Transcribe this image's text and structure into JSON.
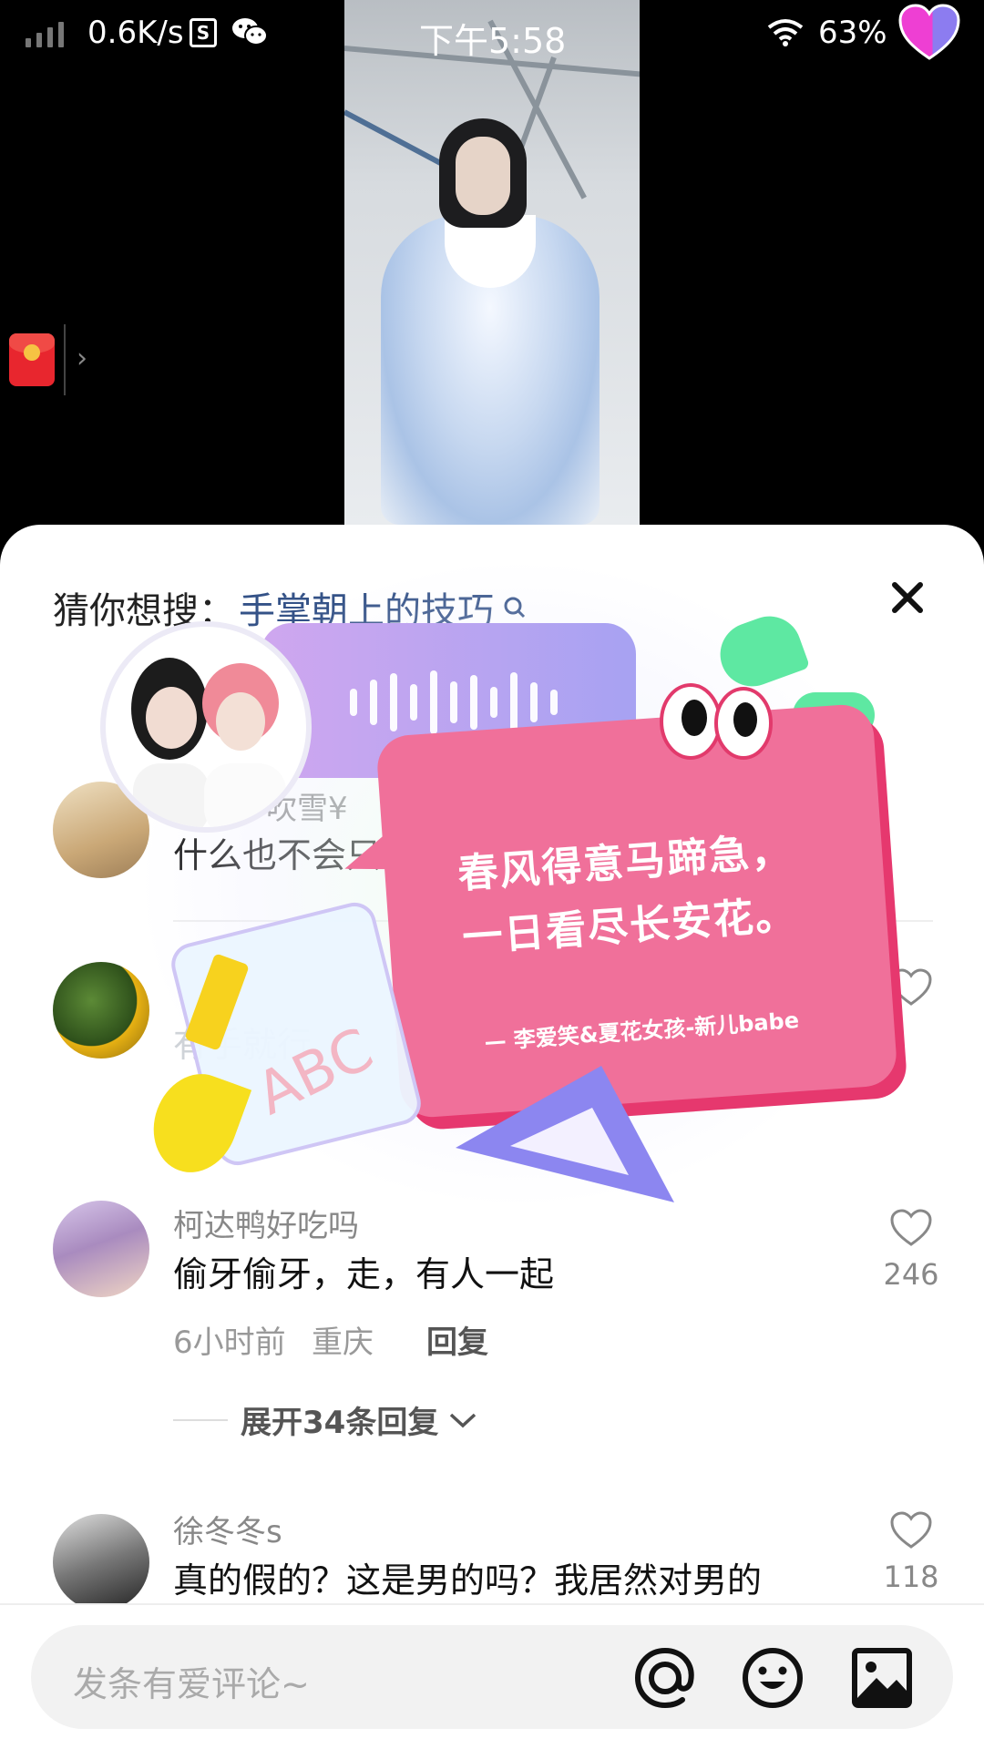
{
  "status_bar": {
    "net_speed": "0.6K/s",
    "s_badge": "S",
    "time": "下午5:58",
    "battery": "63%"
  },
  "suggest": {
    "prefix": "猜你想搜：",
    "keyword": "手掌朝上的技巧"
  },
  "comments": [
    {
      "user": "吹雪¥",
      "text": "什么也不会只会手",
      "like_count": ""
    },
    {
      "user": "",
      "text": "有手就行",
      "like_count": ""
    },
    {
      "user": "柯达鸭好吃吗",
      "text": "偷牙偷牙，走，有人一起",
      "time": "6小时前",
      "location": "重庆",
      "reply_label": "回复",
      "like_count": "246",
      "expand_label": "展开34条回复"
    },
    {
      "user": "徐冬冬s",
      "text": "真的假的？这是男的吗？我居然对男的",
      "like_count": "118"
    }
  ],
  "sticker": {
    "poem_line1": "春风得意马蹄急，",
    "poem_line2": "一日看尽长安花。",
    "credit": "— 李爱笑&夏花女孩-新儿babe",
    "abc": "ABC"
  },
  "input": {
    "placeholder": "发条有爱评论~"
  },
  "icons": {
    "mention": "at-icon",
    "emoji": "emoji-icon",
    "image": "image-icon",
    "close": "close-icon",
    "search": "search-icon",
    "like": "heart-icon"
  },
  "colors": {
    "keyword": "#345287",
    "sticker_pink": "#f0709a",
    "voice_purple": "#a7a2f2"
  }
}
